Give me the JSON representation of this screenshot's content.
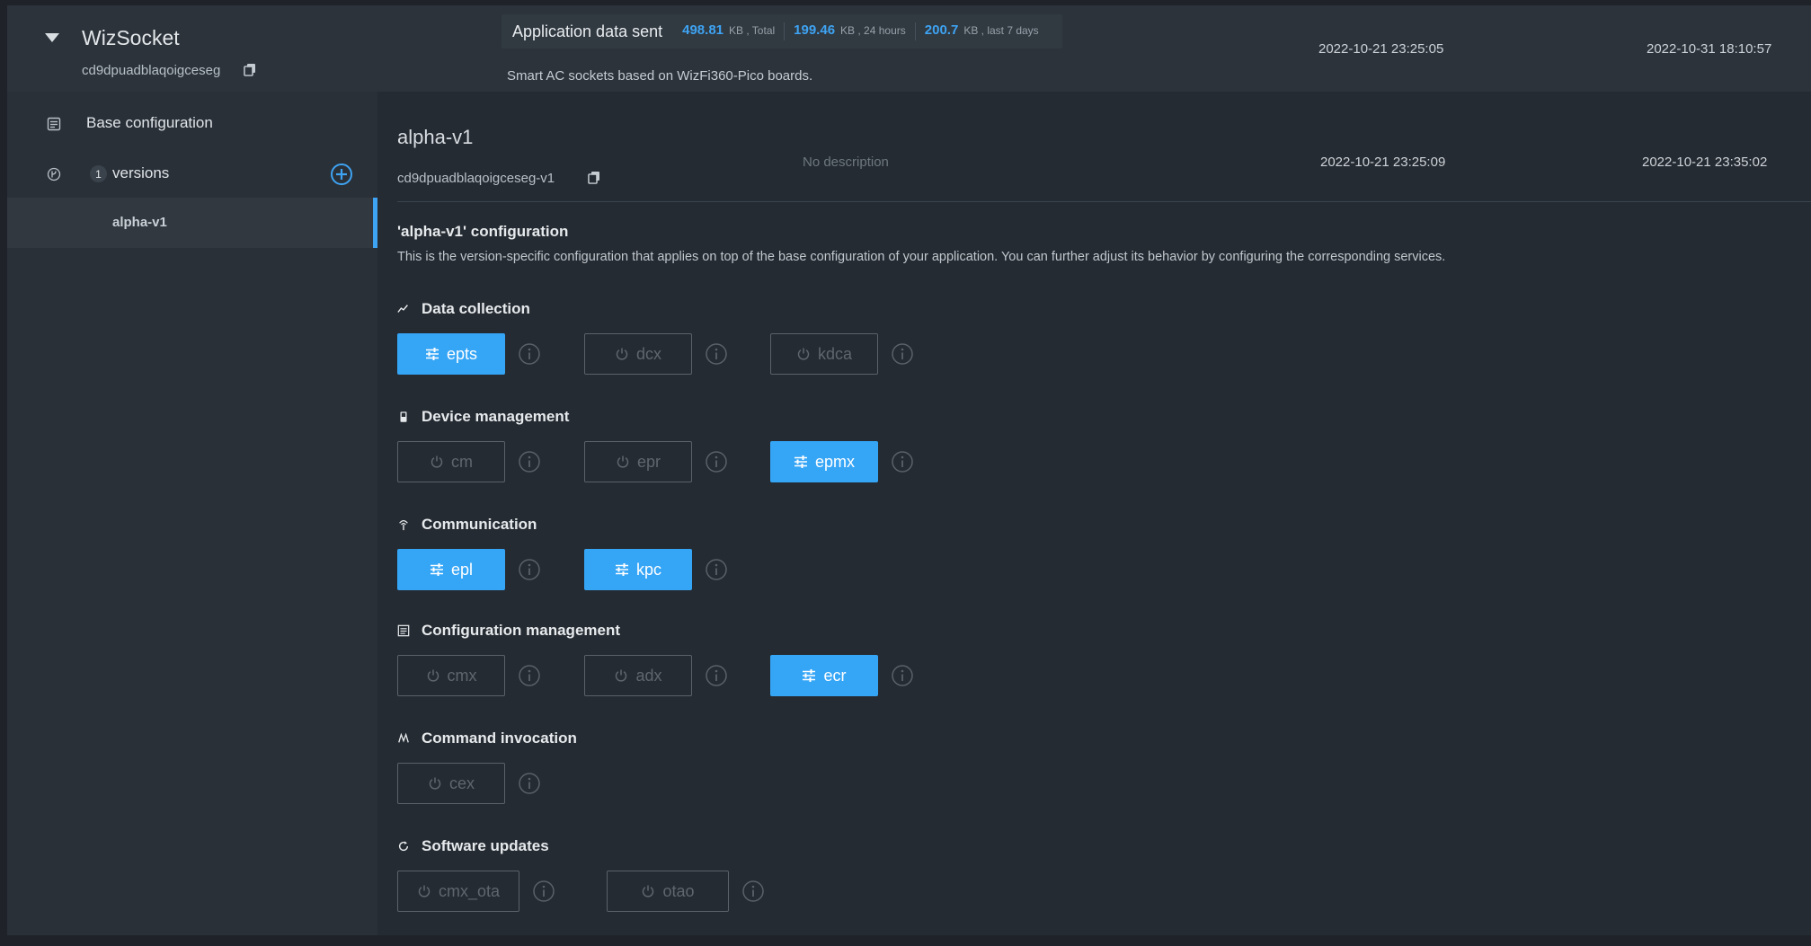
{
  "app": {
    "name": "WizSocket",
    "id": "cd9dpuadblaqoigceseg",
    "description": "Smart AC sockets based on WizFi360-Pico boards.",
    "created": "2022-10-21 23:25:05",
    "updated": "2022-10-31 18:10:57"
  },
  "stats": {
    "title": "Application data sent",
    "items": [
      {
        "value": "498.81",
        "unit": "KB , Total"
      },
      {
        "value": "199.46",
        "unit": "KB , 24 hours"
      },
      {
        "value": "200.7",
        "unit": "KB , last 7 days"
      }
    ]
  },
  "sidebar": {
    "base_config": "Base configuration",
    "versions_count": "1",
    "versions_label": "versions",
    "selected_version": "alpha-v1"
  },
  "version": {
    "title": "alpha-v1",
    "id": "cd9dpuadblaqoigceseg-v1",
    "description": "No description",
    "created": "2022-10-21 23:25:09",
    "updated": "2022-10-21 23:35:02",
    "config_title": "'alpha-v1' configuration",
    "config_subtitle": "This is the version-specific configuration that applies on top of the base configuration of your application. You can further adjust its behavior by configuring the corresponding services."
  },
  "sections": [
    {
      "title": "Data collection",
      "icon": "chart-line-icon",
      "services": [
        {
          "name": "epts",
          "enabled": true
        },
        {
          "name": "dcx",
          "enabled": false
        },
        {
          "name": "kdca",
          "enabled": false
        }
      ]
    },
    {
      "title": "Device management",
      "icon": "device-icon",
      "services": [
        {
          "name": "cm",
          "enabled": false
        },
        {
          "name": "epr",
          "enabled": false
        },
        {
          "name": "epmx",
          "enabled": true
        }
      ]
    },
    {
      "title": "Communication",
      "icon": "antenna-icon",
      "services": [
        {
          "name": "epl",
          "enabled": true
        },
        {
          "name": "kpc",
          "enabled": true
        }
      ]
    },
    {
      "title": "Configuration management",
      "icon": "config-icon",
      "services": [
        {
          "name": "cmx",
          "enabled": false
        },
        {
          "name": "adx",
          "enabled": false
        },
        {
          "name": "ecr",
          "enabled": true
        }
      ]
    },
    {
      "title": "Command invocation",
      "icon": "command-icon",
      "services": [
        {
          "name": "cex",
          "enabled": false
        }
      ]
    },
    {
      "title": "Software updates",
      "icon": "refresh-icon",
      "services": [
        {
          "name": "cmx_ota",
          "enabled": false
        },
        {
          "name": "otao",
          "enabled": false
        }
      ]
    }
  ],
  "colors": {
    "accent": "#35a5f6",
    "background": "#252b32",
    "sidebar": "#2a3038",
    "header": "#2c333b"
  }
}
